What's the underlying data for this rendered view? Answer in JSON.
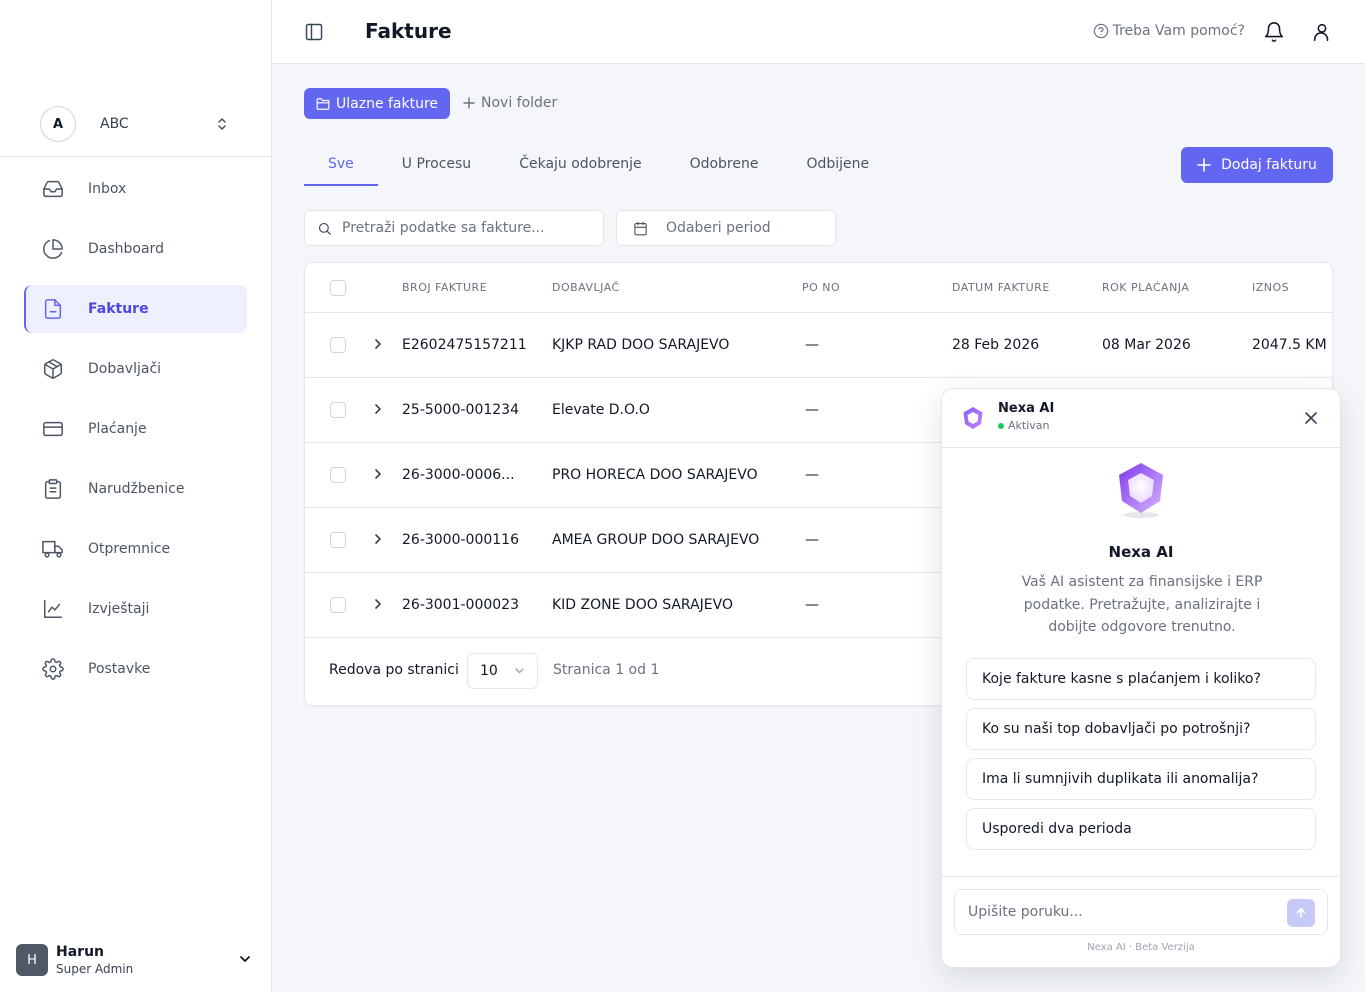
{
  "sidebar": {
    "org": {
      "initial": "A",
      "name": "ABC"
    },
    "items": [
      {
        "label": "Inbox",
        "icon": "inbox-icon"
      },
      {
        "label": "Dashboard",
        "icon": "pie-chart-icon"
      },
      {
        "label": "Fakture",
        "icon": "file-text-icon"
      },
      {
        "label": "Dobavljači",
        "icon": "package-icon"
      },
      {
        "label": "Plaćanje",
        "icon": "credit-card-icon"
      },
      {
        "label": "Narudžbenice",
        "icon": "clipboard-icon"
      },
      {
        "label": "Otpremnice",
        "icon": "truck-icon"
      },
      {
        "label": "Izvještaji",
        "icon": "line-chart-icon"
      },
      {
        "label": "Postavke",
        "icon": "gear-icon"
      }
    ],
    "active_index": 2,
    "user": {
      "initial": "H",
      "name": "Harun",
      "role": "Super Admin"
    }
  },
  "header": {
    "title": "Fakture",
    "help": "Treba Vam pomoć?"
  },
  "folders": {
    "active": "Ulazne fakture",
    "new": "Novi folder"
  },
  "tabs": [
    "Sve",
    "U Procesu",
    "Čekaju odobrenje",
    "Odobrene",
    "Odbijene"
  ],
  "actions": {
    "add_invoice": "Dodaj fakturu"
  },
  "filters": {
    "search_placeholder": "Pretraži podatke sa fakture...",
    "period_placeholder": "Odaberi period"
  },
  "table": {
    "columns": [
      "BROJ FAKTURE",
      "DOBAVLJAČ",
      "PO NO",
      "DATUM FAKTURE",
      "ROK PLAĆANJA",
      "IZNOS"
    ],
    "rows": [
      {
        "number": "E2602475157211",
        "supplier": "KJKP RAD DOO SARAJEVO",
        "po": "—",
        "date": "28 Feb 2026",
        "due": "08 Mar 2026",
        "amount": "2047.5 KM"
      },
      {
        "number": "25-5000-001234",
        "supplier": "Elevate D.O.O",
        "po": "—",
        "date": "",
        "due": "",
        "amount": ""
      },
      {
        "number": "26-3000-0006...",
        "supplier": "PRO HORECA DOO SARAJEVO",
        "po": "—",
        "date": "",
        "due": "",
        "amount": ""
      },
      {
        "number": "26-3000-000116",
        "supplier": "AMEA GROUP DOO SARAJEVO",
        "po": "—",
        "date": "",
        "due": "",
        "amount": ""
      },
      {
        "number": "26-3001-000023",
        "supplier": "KID ZONE DOO SARAJEVO",
        "po": "—",
        "date": "",
        "due": "",
        "amount": ""
      }
    ],
    "footer": {
      "rows_label": "Redova po stranici",
      "rows_value": "10",
      "page_info": "Stranica 1 od 1"
    }
  },
  "ai": {
    "name": "Nexa AI",
    "status": "Aktivan",
    "title": "Nexa AI",
    "description": "Vaš AI asistent za finansijske i ERP podatke. Pretražujte, analizirajte i dobijte odgovore trenutno.",
    "suggestions": [
      "Koje fakture kasne s plaćanjem i koliko?",
      "Ko su naši top dobavljači po potrošnji?",
      "Ima li sumnjivih duplikata ili anomalija?",
      "Usporedi dva perioda"
    ],
    "input_placeholder": "Upišite poruku...",
    "note": "Nexa AI · Beta Verzija"
  },
  "colors": {
    "accent": "#6366f1",
    "status_active": "#22c55e"
  }
}
